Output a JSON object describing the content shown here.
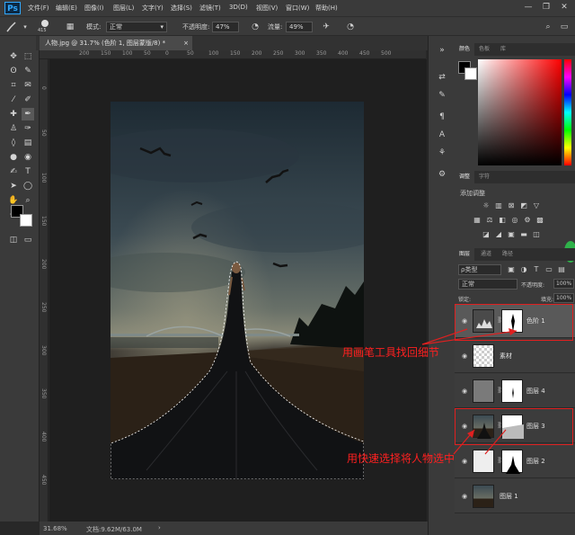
{
  "app": {
    "logo": "Ps"
  },
  "menu": [
    "文件(F)",
    "编辑(E)",
    "图像(I)",
    "图层(L)",
    "文字(Y)",
    "选择(S)",
    "滤镜(T)",
    "3D(D)",
    "视图(V)",
    "窗口(W)",
    "帮助(H)"
  ],
  "window_controls": {
    "minimize": "—",
    "restore": "❐",
    "close": "✕"
  },
  "options": {
    "brush_size": "415",
    "mode_label": "模式:",
    "mode_value": "正常",
    "opacity_label": "不透明度:",
    "opacity_value": "47%",
    "flow_label": "流量:",
    "flow_value": "49%"
  },
  "document": {
    "tab_title": "人物.jpg @ 31.7% (色阶 1, 图层蒙版/8) *",
    "tab_close": "×"
  },
  "ruler": {
    "h_ticks": [
      "200",
      "150",
      "100",
      "50",
      "0",
      "50",
      "100",
      "150",
      "200",
      "250",
      "300",
      "350",
      "400",
      "450",
      "500"
    ],
    "v_ticks": [
      "0",
      "50",
      "100",
      "150",
      "200",
      "250",
      "300",
      "350",
      "400",
      "450"
    ]
  },
  "status": {
    "zoom": "31.68%",
    "doc_info": "文档:9.62M/63.0M",
    "arrow": "›"
  },
  "panels": {
    "color_tabs": [
      "颜色",
      "色板",
      "库"
    ],
    "adjust_tabs": [
      "调整",
      "字符"
    ],
    "adjust_title": "添加调整",
    "layers_tabs": [
      "图层",
      "通道",
      "路径"
    ],
    "filter_kind": "ρ类型",
    "blend_mode": "正常",
    "opacity_label": "不透明度:",
    "opacity_value": "100%",
    "lock_label": "锁定:",
    "fill_label": "填充:",
    "fill_value": "100%"
  },
  "layers": [
    {
      "name": "色阶 1",
      "selected": true
    },
    {
      "name": "素材",
      "selected": false
    },
    {
      "name": "图层 4",
      "selected": false
    },
    {
      "name": "图层 3",
      "selected": false
    },
    {
      "name": "图层 2",
      "selected": false
    },
    {
      "name": "图层 1",
      "selected": false
    }
  ],
  "annotations": {
    "brush_note": "用画笔工具找回细节",
    "select_note": "用快速选择将人物选中"
  },
  "colors": {
    "accent": "#31a8ff",
    "annotation": "#ff2020",
    "panel_bg": "#3a3a3a",
    "canvas_bg": "#1f1f1f"
  }
}
